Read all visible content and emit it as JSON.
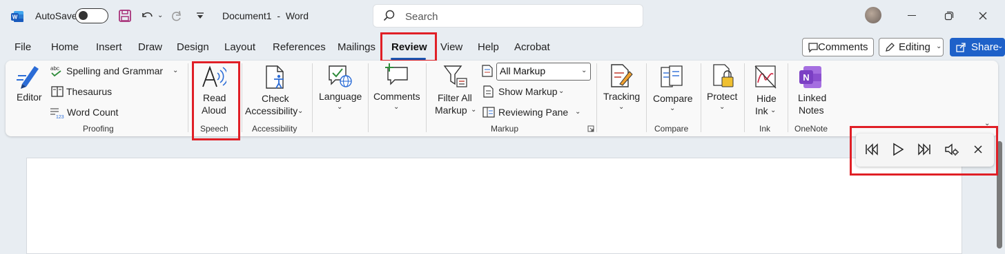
{
  "titlebar": {
    "autosave_label": "AutoSave",
    "doc_title": "Document1  -  Word",
    "search_placeholder": "Search"
  },
  "tabs": [
    "File",
    "Home",
    "Insert",
    "Draw",
    "Design",
    "Layout",
    "References",
    "Mailings",
    "Review",
    "View",
    "Help",
    "Acrobat"
  ],
  "active_tab": "Review",
  "top_buttons": {
    "comments": "Comments",
    "editing": "Editing",
    "share": "Share"
  },
  "ribbon": {
    "proofing": {
      "editor": "Editor",
      "spelling": "Spelling and Grammar",
      "thesaurus": "Thesaurus",
      "word_count": "Word Count",
      "group": "Proofing"
    },
    "speech": {
      "read": "Read",
      "aloud": "Aloud",
      "group": "Speech"
    },
    "accessibility": {
      "check": "Check",
      "accessibility": "Accessibility",
      "group": "Accessibility"
    },
    "language": {
      "label": "Language"
    },
    "comments": {
      "label": "Comments"
    },
    "markup": {
      "filter_all": "Filter All",
      "markup": "Markup",
      "select_value": "All Markup",
      "show_markup": "Show Markup",
      "reviewing_pane": "Reviewing Pane",
      "group": "Markup"
    },
    "tracking": {
      "label": "Tracking"
    },
    "compare": {
      "label": "Compare",
      "group": "Compare"
    },
    "protect": {
      "label": "Protect"
    },
    "ink": {
      "hide": "Hide",
      "ink": "Ink",
      "group": "Ink"
    },
    "onenote": {
      "linked": "Linked",
      "notes": "Notes",
      "group": "OneNote"
    }
  },
  "colors": {
    "accent_blue": "#1e61c9",
    "highlight_red": "#e01f26",
    "onenote_purple": "#7b3fc4"
  },
  "read_aloud_toolbar": {
    "icons": [
      "previous-paragraph-icon",
      "play-icon",
      "next-paragraph-icon",
      "voice-settings-icon",
      "close-icon"
    ]
  }
}
